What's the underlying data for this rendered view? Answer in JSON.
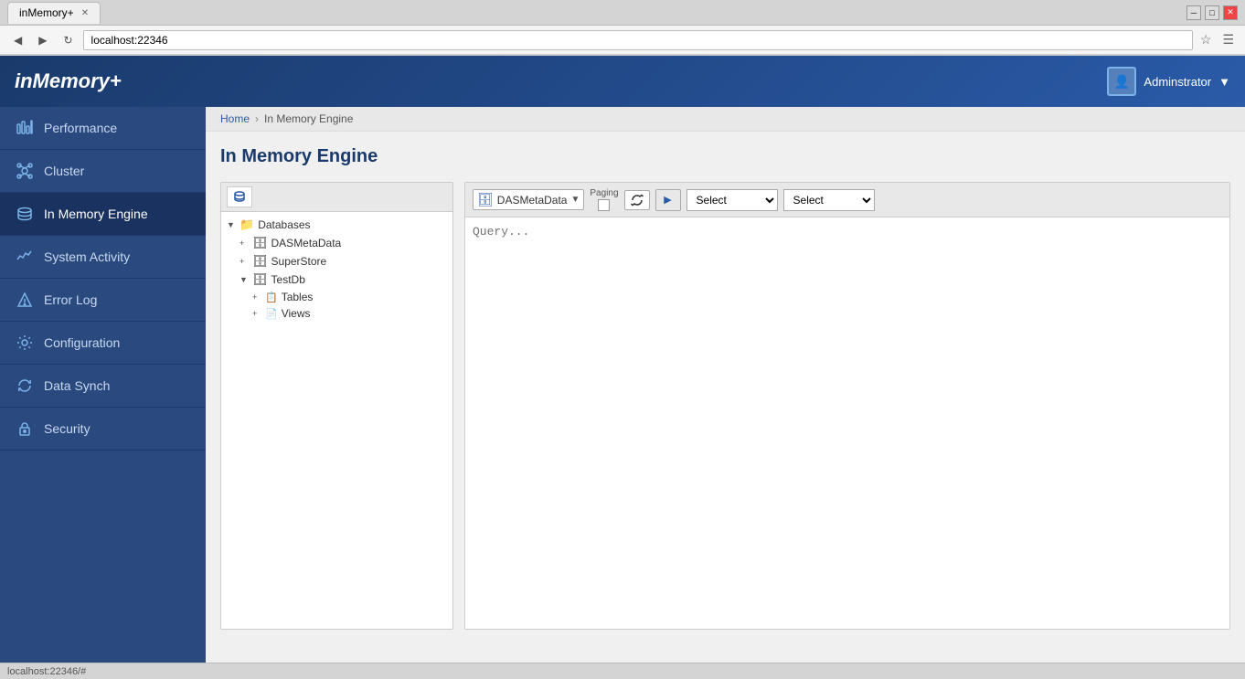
{
  "browser": {
    "tab_title": "inMemory+",
    "address": "localhost:22346",
    "status_url": "localhost:22346/#"
  },
  "app": {
    "logo": "inMemory+",
    "user": "Adminstrator"
  },
  "sidebar": {
    "items": [
      {
        "id": "performance",
        "label": "Performance",
        "icon": "⚡"
      },
      {
        "id": "cluster",
        "label": "Cluster",
        "icon": "🔗"
      },
      {
        "id": "in-memory-engine",
        "label": "In Memory Engine",
        "icon": "🗄"
      },
      {
        "id": "system-activity",
        "label": "System Activity",
        "icon": "📊"
      },
      {
        "id": "error-log",
        "label": "Error Log",
        "icon": "⚠"
      },
      {
        "id": "configuration",
        "label": "Configuration",
        "icon": "⚙"
      },
      {
        "id": "data-synch",
        "label": "Data Synch",
        "icon": "🔄"
      },
      {
        "id": "security",
        "label": "Security",
        "icon": "🔒"
      }
    ]
  },
  "breadcrumb": {
    "home": "Home",
    "current": "In Memory Engine"
  },
  "page": {
    "title": "In Memory Engine"
  },
  "tree": {
    "root_label": "Databases",
    "nodes": [
      {
        "label": "Databases",
        "type": "root"
      },
      {
        "label": "DASMetaData",
        "type": "db"
      },
      {
        "label": "SuperStore",
        "type": "db"
      },
      {
        "label": "TestDb",
        "type": "db"
      },
      {
        "label": "Tables",
        "type": "folder"
      },
      {
        "label": "Views",
        "type": "folder"
      }
    ]
  },
  "toolbar": {
    "db_name": "DASMetaData",
    "paging_label": "Paging",
    "select1_label": "Select",
    "select2_label": "Select",
    "select1_options": [
      "Select"
    ],
    "select2_options": [
      "Select"
    ],
    "query_placeholder": "Query..."
  }
}
